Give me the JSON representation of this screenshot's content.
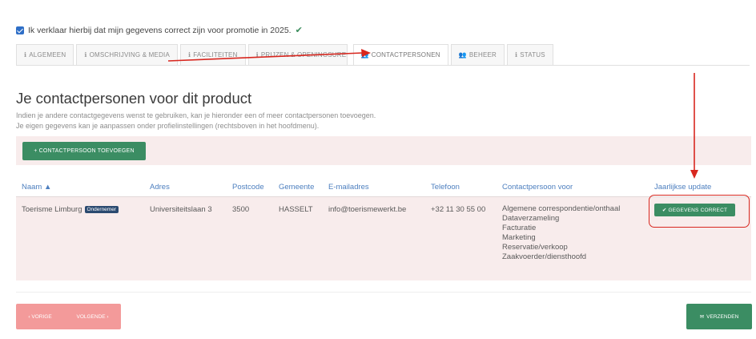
{
  "confirmation": {
    "text": "Ik verklaar hierbij dat mijn gegevens correct zijn voor promotie in 2025.",
    "check": "✔"
  },
  "tabs": [
    {
      "icon": "ℹ",
      "label": "ALGEMEEN"
    },
    {
      "icon": "ℹ",
      "label": "OMSCHRIJVING & MEDIA"
    },
    {
      "icon": "ℹ",
      "label": "FACILITEITEN"
    },
    {
      "icon": "ℹ",
      "label": "PRIJZEN & OPENINGSUREN"
    },
    {
      "icon": "👥",
      "label": "CONTACTPERSONEN"
    },
    {
      "icon": "👥",
      "label": "BEHEER"
    },
    {
      "icon": "ℹ",
      "label": "STATUS"
    }
  ],
  "page": {
    "title": "Je contactpersonen voor dit product",
    "intro_line1": "Indien je andere contactgegevens wenst te gebruiken, kan je hieronder een of meer contactpersonen toevoegen.",
    "intro_line2": "Je eigen gegevens kan je aanpassen onder profielinstellingen (rechtsboven in het hoofdmenu).",
    "add_button": "+ CONTACTPERSOON TOEVOEGEN"
  },
  "table": {
    "headers": {
      "naam": "Naam ▲",
      "adres": "Adres",
      "postcode": "Postcode",
      "gemeente": "Gemeente",
      "email": "E-mailadres",
      "telefoon": "Telefoon",
      "contactpersoon_voor": "Contactpersoon voor",
      "jaarlijkse_update": "Jaarlijkse update"
    },
    "row": {
      "naam": "Toerisme Limburg",
      "badge": "Ondernemer",
      "adres": "Universiteitslaan 3",
      "postcode": "3500",
      "gemeente": "HASSELT",
      "email": "info@toerismewerkt.be",
      "telefoon": "+32 11 30 55 00",
      "contactpersoon_voor": [
        "Algemene correspondentie/onthaal",
        "Dataverzameling",
        "Facturatie",
        "Marketing",
        "Reservatie/verkoop",
        "Zaakvoerder/diensthoofd"
      ],
      "status_button": "✔ GEGEVENS CORRECT"
    }
  },
  "footer": {
    "prev": "‹ VORIGE",
    "next": "VOLGENDE ›",
    "send_icon": "✉",
    "send": "VERZENDEN"
  },
  "colors": {
    "accent_green": "#3b8d63",
    "link_blue": "#4d7fbf",
    "row_pink": "#f8ecec",
    "annotation_red": "#d8271f",
    "pager_pink": "#f39a9a"
  }
}
